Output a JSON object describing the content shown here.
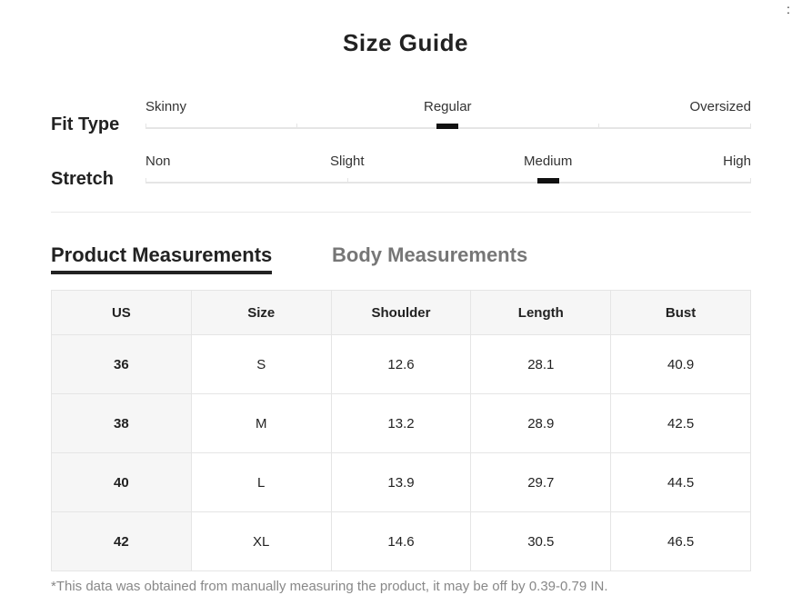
{
  "title": "Size Guide",
  "corner_mark": ":",
  "fit_type": {
    "label": "Fit Type",
    "options": [
      "Skinny",
      "Regular",
      "Oversized"
    ],
    "selected": "Regular"
  },
  "stretch": {
    "label": "Stretch",
    "options": [
      "Non",
      "Slight",
      "Medium",
      "High"
    ],
    "selected": "Medium"
  },
  "tabs": {
    "product": "Product Measurements",
    "body": "Body Measurements",
    "active": "product"
  },
  "table": {
    "headers": [
      "US",
      "Size",
      "Shoulder",
      "Length",
      "Bust"
    ],
    "rows": [
      [
        "36",
        "S",
        "12.6",
        "28.1",
        "40.9"
      ],
      [
        "38",
        "M",
        "13.2",
        "28.9",
        "42.5"
      ],
      [
        "40",
        "L",
        "13.9",
        "29.7",
        "44.5"
      ],
      [
        "42",
        "XL",
        "14.6",
        "30.5",
        "46.5"
      ]
    ]
  },
  "footnote": "*This data was obtained from manually measuring the product, it may be off by 0.39-0.79 IN.",
  "colors": {
    "text": "#222222",
    "muted": "#767676",
    "header_bg": "#f6f6f6",
    "indicator": "#111111",
    "border": "#e5e5e5"
  }
}
